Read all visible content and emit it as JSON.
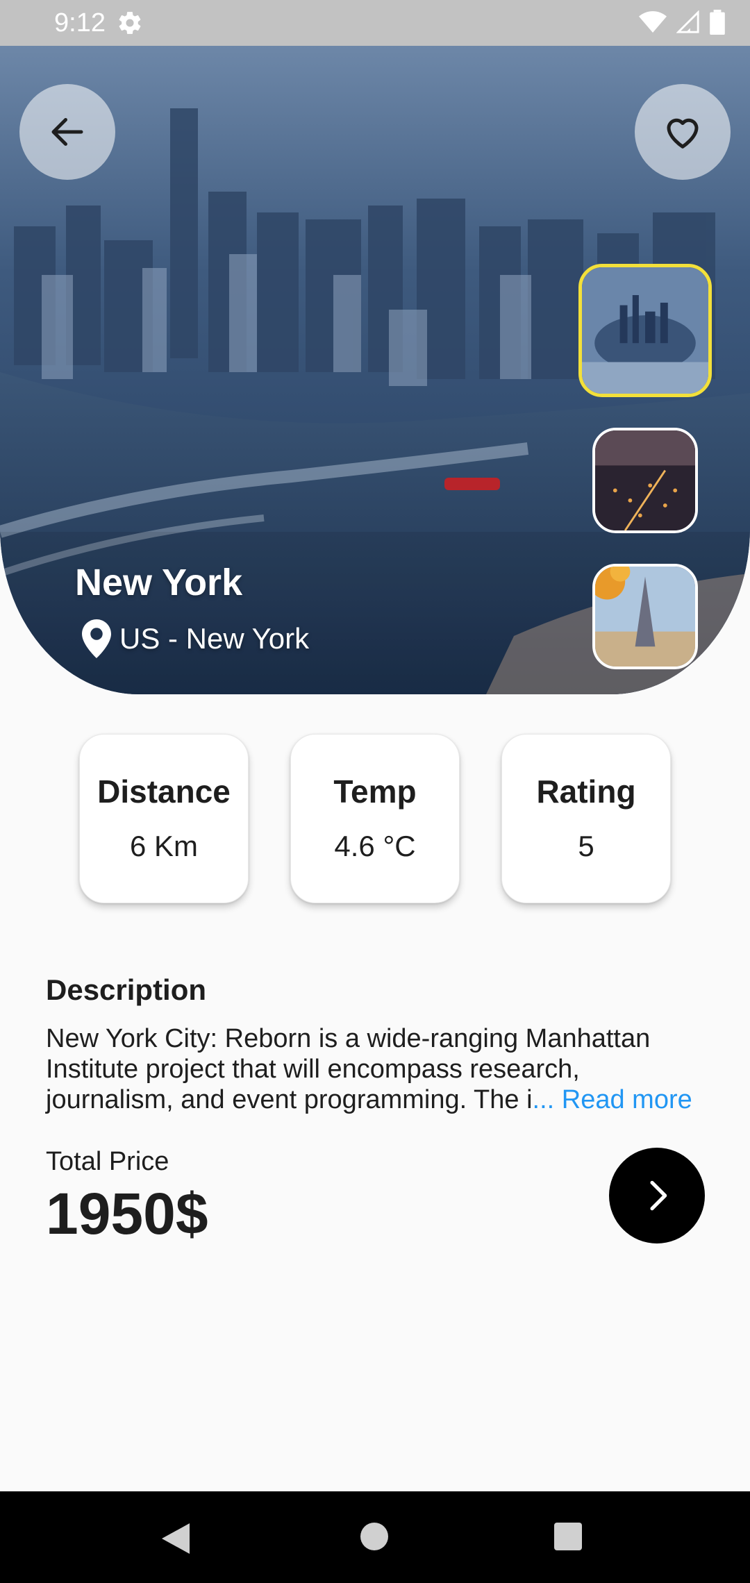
{
  "status_bar": {
    "time": "9:12",
    "icons": [
      "gear-icon",
      "wifi-icon",
      "signal-icon",
      "battery-icon"
    ]
  },
  "hero": {
    "city_name": "New York",
    "location": "US - New York",
    "back_icon": "arrow-left-icon",
    "favorite_icon": "heart-outline-icon",
    "location_icon": "map-pin-icon",
    "thumbnails": [
      {
        "name": "new-york-aerial",
        "selected": true
      },
      {
        "name": "city-night-lights",
        "selected": false
      },
      {
        "name": "paris-eiffel-tower",
        "selected": false
      }
    ],
    "selected_border_color": "#f3e03a"
  },
  "info_cards": [
    {
      "label": "Distance",
      "value": "6 Km"
    },
    {
      "label": "Temp",
      "value": "4.6 °C"
    },
    {
      "label": "Rating",
      "value": "5"
    }
  ],
  "description": {
    "title": "Description",
    "lines": [
      "New York City: Reborn is a wide-ranging Manhattan",
      "Institute project that will encompass research,",
      "journalism, and event programming. The i"
    ],
    "read_more": "... Read more",
    "read_more_color": "#2196f3"
  },
  "price": {
    "label": "Total Price",
    "value": "1950$"
  },
  "next_button": {
    "icon": "chevron-right-icon"
  },
  "nav_bar": {
    "icons": [
      "nav-back-icon",
      "nav-home-icon",
      "nav-recents-icon"
    ]
  }
}
